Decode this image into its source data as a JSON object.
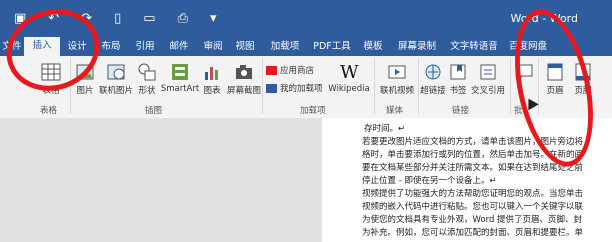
{
  "title_bar": {
    "doc_title": "Word - Word"
  },
  "tabs": [
    {
      "label": "文件"
    },
    {
      "label": "插入"
    },
    {
      "label": "设计"
    },
    {
      "label": "布局"
    },
    {
      "label": "引用"
    },
    {
      "label": "邮件"
    },
    {
      "label": "审阅"
    },
    {
      "label": "视图"
    },
    {
      "label": "加载项"
    },
    {
      "label": "PDF工具"
    },
    {
      "label": "模板"
    },
    {
      "label": "屏幕录制"
    },
    {
      "label": "文字转语音"
    },
    {
      "label": "百度网盘"
    }
  ],
  "ribbon": {
    "tables": {
      "table": "表格",
      "group": "表格"
    },
    "illustrations": {
      "picture": "图片",
      "online_picture": "联机图片",
      "shapes": "形状",
      "smartart": "SmartArt",
      "chart": "图表",
      "screenshot": "屏幕截图",
      "group": "插图"
    },
    "addins": {
      "store": "应用商店",
      "my_addins": "我的加载项",
      "wikipedia": "Wikipedia",
      "group": "加载项"
    },
    "media": {
      "online_video": "联机视频",
      "group": "媒体"
    },
    "links": {
      "hyperlink": "超链接",
      "bookmark": "书签",
      "cross_ref": "交叉引用",
      "group": "链接"
    },
    "comments": {
      "comment": "批注",
      "group": "批"
    },
    "header_footer": {
      "header": "页眉",
      "footer": "页脚"
    }
  },
  "document": {
    "lines": [
      "存时间。↵",
      "若要更改图片适应文档的方式，请单击该图片，图片旁边将",
      "格时，单击要添加行或列的位置，然后单击加号。在新的阅",
      "要在文档某些部分并关注所需文本。如果在达到结尾处之前",
      "停止位置 - 即使在另一个设备上。↵",
      "视频提供了功能强大的方法帮助您证明您的观点。当您单击",
      "视频的嵌入代码中进行粘贴。您也可以键入一个关键字以联",
      "为使您的文档具有专业外观，Word 提供了页眉、页脚、封",
      "为补充。例如，您可以添加匹配的封面、页眉和提要栏。单"
    ]
  },
  "colors": {
    "titlebar": "#2e5c9c",
    "annotation": "#e8191d"
  }
}
